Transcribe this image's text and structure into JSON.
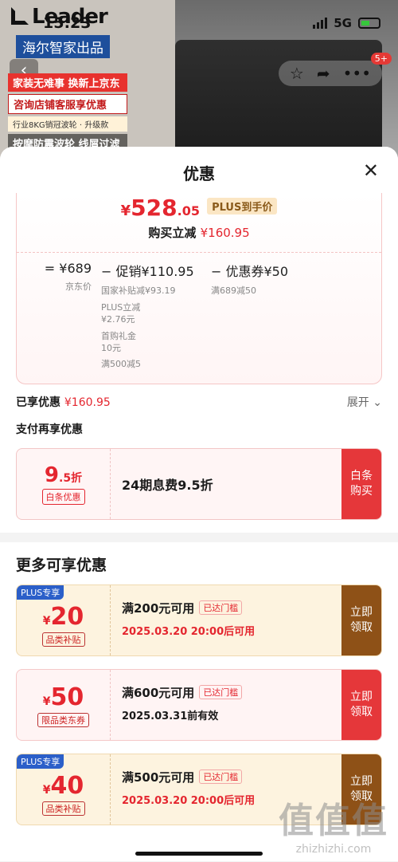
{
  "status_bar": {
    "time": "15:23",
    "network": "5G"
  },
  "background": {
    "brand": "Leader",
    "haier_label": "海尔智家出品",
    "promo": [
      "家装无难事 换新上京东",
      "咨询店铺客服享优惠",
      "行业8KG销冠波轮 · 升级款",
      "按摩防震波轮 线屑过滤"
    ],
    "cart_badge": "5+"
  },
  "sheet": {
    "title": "优惠",
    "price": {
      "yen": "¥",
      "int": "528",
      "dec": ".05",
      "plus_tag": "PLUS到手价"
    },
    "instant": {
      "label": "购买立减",
      "amount": "¥160.95"
    },
    "breakdown": {
      "jd_price": {
        "value": "= ¥689",
        "label": "京东价"
      },
      "promo": {
        "value": "− 促销¥110.95",
        "items": [
          "国家补贴减¥93.19",
          "PLUS立减",
          "¥2.76元",
          "首购礼金",
          "10元",
          "满500减5"
        ]
      },
      "coupon": {
        "value": "− 优惠券¥50",
        "items": [
          "满689减50"
        ]
      }
    },
    "enjoyed": {
      "label": "已享优惠",
      "amount": "¥160.95",
      "expand": "展开"
    },
    "pay_title": "支付再享优惠",
    "baitiao": {
      "rate": "9",
      "rate_suffix": ".5折",
      "tag": "白条优惠",
      "desc": "24期息费9.5折",
      "button": "白条购买"
    },
    "more_title": "更多可享优惠",
    "coupons": [
      {
        "plus": "PLUS专享",
        "yen": "¥",
        "amount": "20",
        "tag": "品类补贴",
        "condition": "满200元可用",
        "badge": "已达门槛",
        "note": "2025.03.20 20:00后可用",
        "button": "立即领取"
      },
      {
        "plus": "",
        "yen": "¥",
        "amount": "50",
        "tag": "限品类东券",
        "condition": "满600元可用",
        "badge": "已达门槛",
        "note": "2025.03.31前有效",
        "button": "立即领取"
      },
      {
        "plus": "PLUS专享",
        "yen": "¥",
        "amount": "40",
        "tag": "品类补贴",
        "condition": "满500元可用",
        "badge": "已达门槛",
        "note": "2025.03.20 20:00后可用",
        "button": "立即领取"
      }
    ]
  },
  "watermark": {
    "logo": "值值值",
    "url": "zhizhizhi.com"
  }
}
